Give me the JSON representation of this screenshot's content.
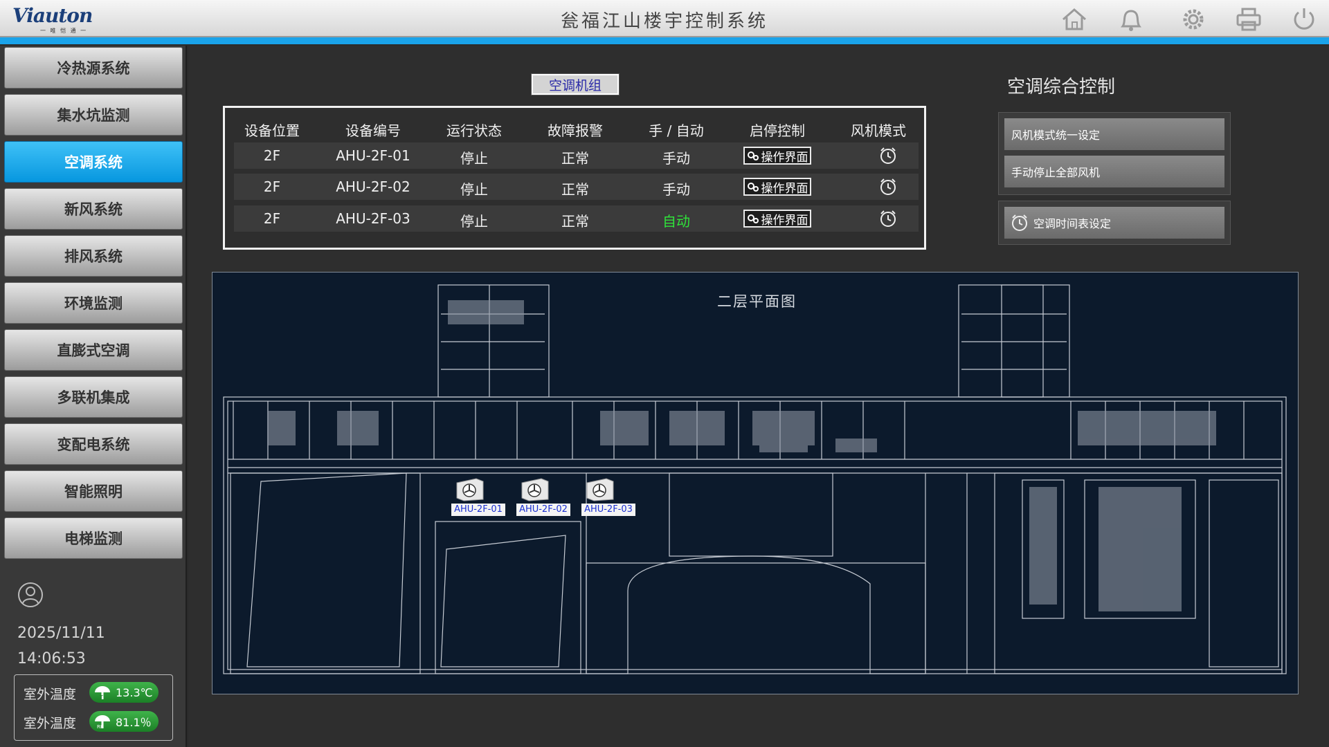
{
  "header": {
    "logo_text": "Viauton",
    "logo_sub": "一 唯 恺 通 一",
    "title": "瓮福江山楼宇控制系统",
    "icons": [
      "home-icon",
      "bell-icon",
      "gear-icon",
      "printer-icon",
      "power-icon"
    ]
  },
  "sidebar": {
    "items": [
      {
        "label": "冷热源系统"
      },
      {
        "label": "集水坑监测"
      },
      {
        "label": "空调系统"
      },
      {
        "label": "新风系统"
      },
      {
        "label": "排风系统"
      },
      {
        "label": "环境监测"
      },
      {
        "label": "直膨式空调"
      },
      {
        "label": "多联机集成"
      },
      {
        "label": "变配电系统"
      },
      {
        "label": "智能照明"
      },
      {
        "label": "电梯监测"
      }
    ],
    "active_index": 2,
    "date": "2025/11/11",
    "time": "14:06:53",
    "weather": {
      "temp_label": "室外温度",
      "temp_value": "13.3℃",
      "humidity_label": "室外温度",
      "humidity_value": "81.1％"
    }
  },
  "main": {
    "section_tab": "空调机组",
    "table": {
      "headers": [
        "设备位置",
        "设备编号",
        "运行状态",
        "故障报警",
        "手 / 自动",
        "启停控制",
        "风机模式"
      ],
      "rows": [
        {
          "location": "2F",
          "id": "AHU-2F-01",
          "status": "停止",
          "alarm": "正常",
          "mode": "手动",
          "control": "操作界面"
        },
        {
          "location": "2F",
          "id": "AHU-2F-02",
          "status": "停止",
          "alarm": "正常",
          "mode": "手动",
          "control": "操作界面"
        },
        {
          "location": "2F",
          "id": "AHU-2F-03",
          "status": "停止",
          "alarm": "正常",
          "mode": "自动",
          "control": "操作界面"
        }
      ]
    },
    "control": {
      "title": "空调综合控制",
      "btn_fan_mode": "风机模式统一设定",
      "btn_stop_all": "手动停止全部风机",
      "btn_schedule": "空调时间表设定"
    },
    "plan": {
      "title": "二层平面图",
      "units": [
        "AHU-2F-01",
        "AHU-2F-02",
        "AHU-2F-03"
      ]
    }
  },
  "colors": {
    "accent_blue": "#1aa3ea",
    "auto_green": "#2fe33a",
    "plan_bg": "#0c1a2c"
  }
}
